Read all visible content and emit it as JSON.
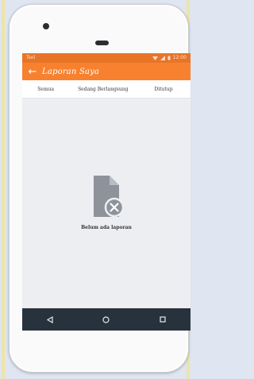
{
  "status_bar": {
    "carrier": "Tsel",
    "time": "12:00"
  },
  "app_bar": {
    "title": "Laporan Saya",
    "back_icon": "arrow-left-icon"
  },
  "tabs": [
    {
      "label": "Semua"
    },
    {
      "label": "Sedang Berlangsung"
    },
    {
      "label": "Ditutup"
    }
  ],
  "empty_state": {
    "icon": "document-remove-icon",
    "message": "Belum ada laporan"
  },
  "nav_bar": {
    "back_icon": "triangle-back-icon",
    "home_icon": "circle-home-icon",
    "recents_icon": "square-recents-icon"
  },
  "colors": {
    "accent": "#f7812f",
    "status_bar": "#e87428",
    "nav_bar": "#27323d",
    "screen_bg": "#eceef1"
  }
}
